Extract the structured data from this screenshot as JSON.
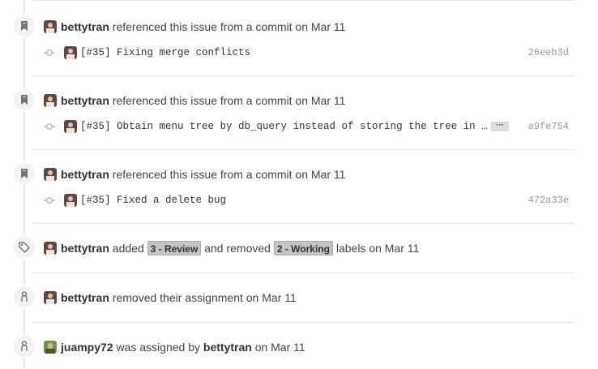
{
  "events": [
    {
      "author": "bettytran",
      "text": "referenced this issue from a commit on Mar 11",
      "commit_message": "[#35] Fixing merge conflicts",
      "sha": "26eeb3d"
    },
    {
      "author": "bettytran",
      "text": "referenced this issue from a commit on Mar 11",
      "commit_message": "[#35] Obtain menu tree by db_query instead of storing the tree in the…",
      "ellipsis": "…",
      "sha": "a9fe754"
    },
    {
      "author": "bettytran",
      "text": "referenced this issue from a commit on Mar 11",
      "commit_message": "[#35] Fixed a delete bug",
      "sha": "472a33e"
    }
  ],
  "label_event": {
    "author": "bettytran",
    "added_text": "added",
    "added_label": "3 - Review",
    "removed_text": "and removed",
    "removed_label": "2 - Working",
    "suffix": "labels on Mar 11"
  },
  "unassign_event": {
    "author": "bettytran",
    "text": "removed their assignment on Mar 11"
  },
  "assign_event": {
    "assignee": "juampy72",
    "middle_text": "was assigned by",
    "assigner": "bettytran",
    "suffix": "on Mar 11"
  },
  "icons": {
    "reference": "bookmark-icon",
    "commit": "git-commit-icon",
    "label": "tag-icon",
    "person": "person-icon"
  },
  "colors": {
    "label_bg": "#c4c4c4",
    "sha": "#999999",
    "timeline": "#e6e6e6"
  }
}
